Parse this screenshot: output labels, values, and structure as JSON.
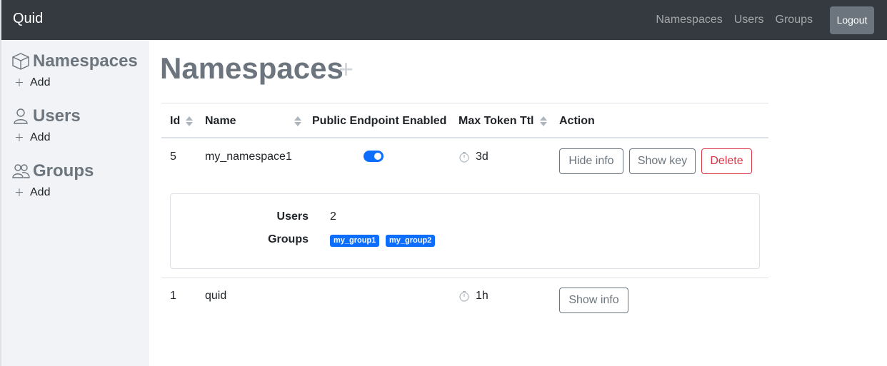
{
  "navbar": {
    "brand": "Quid",
    "links": [
      "Namespaces",
      "Users",
      "Groups"
    ],
    "logout_label": "Logout"
  },
  "sidebar": {
    "sections": [
      {
        "title": "Namespaces",
        "icon": "box-icon",
        "add_label": "Add"
      },
      {
        "title": "Users",
        "icon": "user-icon",
        "add_label": "Add"
      },
      {
        "title": "Groups",
        "icon": "people-icon",
        "add_label": "Add"
      }
    ]
  },
  "main": {
    "title": "Namespaces",
    "add_symbol": "+",
    "table": {
      "headers": [
        "Id",
        "Name",
        "Public Endpoint Enabled",
        "Max Token Ttl",
        "Action"
      ],
      "rows": [
        {
          "id": "5",
          "name": "my_namespace1",
          "public_endpoint_enabled": true,
          "max_token_ttl": "3d",
          "actions": [
            "Hide info",
            "Show key",
            "Delete"
          ],
          "info": {
            "users_label": "Users",
            "users_value": "2",
            "groups_label": "Groups",
            "groups": [
              "my_group1",
              "my_group2"
            ]
          }
        },
        {
          "id": "1",
          "name": "quid",
          "public_endpoint_enabled": false,
          "max_token_ttl": "1h",
          "actions": [
            "Show info"
          ]
        }
      ]
    }
  },
  "colors": {
    "navbar_bg": "#343a40",
    "sidebar_bg": "#f1f3f6",
    "primary": "#0d6efd",
    "danger": "#dc3545",
    "secondary": "#6c757d"
  }
}
